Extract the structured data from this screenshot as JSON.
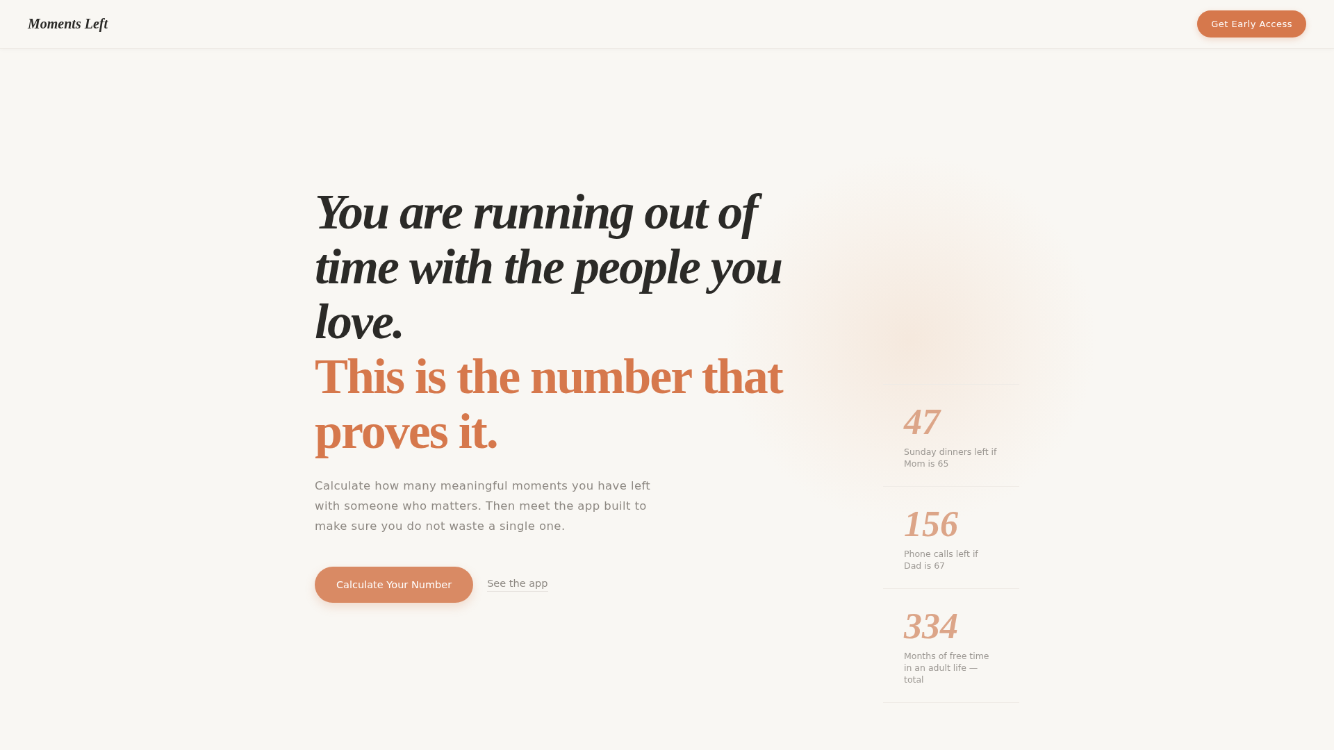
{
  "header": {
    "logo": "Moments Left",
    "cta": "Get Early Access"
  },
  "hero": {
    "headline": "You are running out of time with the people you love.",
    "accent": "This is the number that proves it.",
    "description": "Calculate how many meaningful moments you have left with someone who matters. Then meet the app built to make sure you do not waste a single one.",
    "primary_button": "Calculate Your Number",
    "secondary_link": "See the app"
  },
  "stats": [
    {
      "number": "47",
      "label": "Sunday dinners left if Mom is 65"
    },
    {
      "number": "156",
      "label": "Phone calls left if Dad is 67"
    },
    {
      "number": "334",
      "label": "Months of free time in an adult life — total"
    }
  ]
}
